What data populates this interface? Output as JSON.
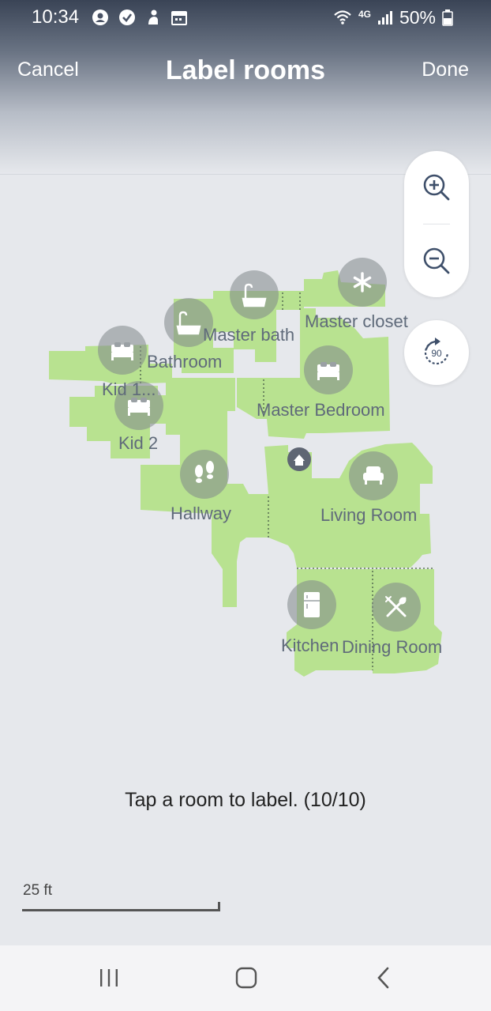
{
  "status_bar": {
    "time": "10:34",
    "network_label": "4G",
    "battery_percent": "50%"
  },
  "header": {
    "title": "Label rooms",
    "cancel_label": "Cancel",
    "done_label": "Done"
  },
  "controls": {
    "zoom_in_icon": "zoom-in-icon",
    "zoom_out_icon": "zoom-out-icon",
    "rotate_label": "90"
  },
  "rooms": [
    {
      "name": "Master bath",
      "icon": "bathtub-icon"
    },
    {
      "name": "Master closet",
      "icon": "asterisk-icon"
    },
    {
      "name": "Bathroom",
      "icon": "bathtub-icon"
    },
    {
      "name": "Kid 1...",
      "icon": "bed-icon"
    },
    {
      "name": "Kid 2",
      "icon": "bed-icon"
    },
    {
      "name": "Master Bedroom",
      "icon": "bed-icon"
    },
    {
      "name": "Hallway",
      "icon": "footprints-icon"
    },
    {
      "name": "Living Room",
      "icon": "armchair-icon"
    },
    {
      "name": "Kitchen",
      "icon": "refrigerator-icon"
    },
    {
      "name": "Dining Room",
      "icon": "fork-knife-icon"
    }
  ],
  "instruction": "Tap a room to label. (10/10)",
  "scale": {
    "label": "25 ft"
  },
  "colors": {
    "map_fill": "#b8e290",
    "background": "#e6e8ec",
    "label_text": "#5f6a7a"
  }
}
